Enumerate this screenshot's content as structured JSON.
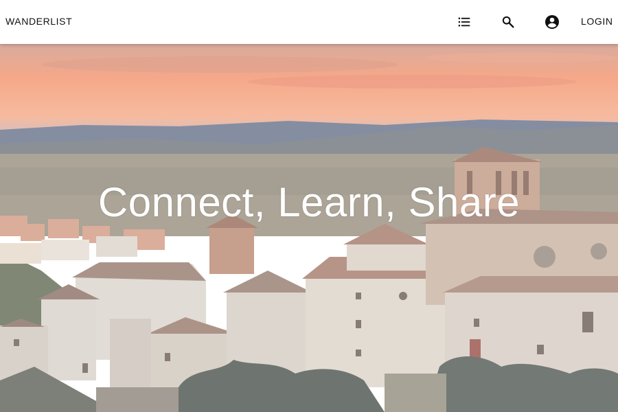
{
  "header": {
    "brand": "WANDERLIST",
    "list_icon": "format-list-icon",
    "search_icon": "search-icon",
    "account_icon": "account-circle-icon",
    "login_label": "LOGIN"
  },
  "hero": {
    "headline": "Connect, Learn, Share",
    "image_description_icon": "hero-photo"
  },
  "colors": {
    "header_bg": "#ffffff",
    "header_text": "#111111",
    "headline": "#ffffff",
    "sky_top": "#d9a48e",
    "sky_band": "#f08a5d"
  }
}
